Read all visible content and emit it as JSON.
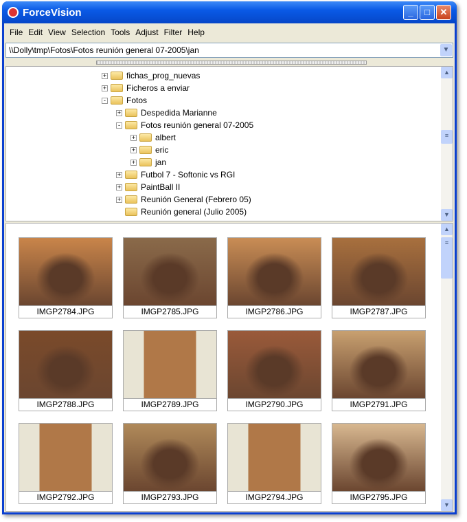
{
  "title": "ForceVision",
  "menu": [
    "File",
    "Edit",
    "View",
    "Selection",
    "Tools",
    "Adjust",
    "Filter",
    "Help"
  ],
  "address": "\\\\Dolly\\tmp\\Fotos\\Fotos reunión general 07-2005\\jan",
  "tree": [
    {
      "label": "fichas_prog_nuevas",
      "level": 0,
      "state": "+"
    },
    {
      "label": "Ficheros a enviar",
      "level": 0,
      "state": "+"
    },
    {
      "label": "Fotos",
      "level": 0,
      "state": "-"
    },
    {
      "label": "Despedida Marianne",
      "level": 1,
      "state": "+"
    },
    {
      "label": "Fotos reunión general 07-2005",
      "level": 1,
      "state": "-"
    },
    {
      "label": "albert",
      "level": 2,
      "state": "+"
    },
    {
      "label": "eric",
      "level": 2,
      "state": "+"
    },
    {
      "label": "jan",
      "level": 2,
      "state": "+"
    },
    {
      "label": "Futbol 7 - Softonic vs RGI",
      "level": 1,
      "state": "+"
    },
    {
      "label": "PaintBall II",
      "level": 1,
      "state": "+"
    },
    {
      "label": "Reunión General (Febrero 05)",
      "level": 1,
      "state": "+"
    },
    {
      "label": "Reunión general (Julio 2005)",
      "level": 1,
      "state": ""
    }
  ],
  "thumbnails": [
    "IMGP2784.JPG",
    "IMGP2785.JPG",
    "IMGP2786.JPG",
    "IMGP2787.JPG",
    "IMGP2788.JPG",
    "IMGP2789.JPG",
    "IMGP2790.JPG",
    "IMGP2791.JPG",
    "IMGP2792.JPG",
    "IMGP2793.JPG",
    "IMGP2794.JPG",
    "IMGP2795.JPG"
  ]
}
